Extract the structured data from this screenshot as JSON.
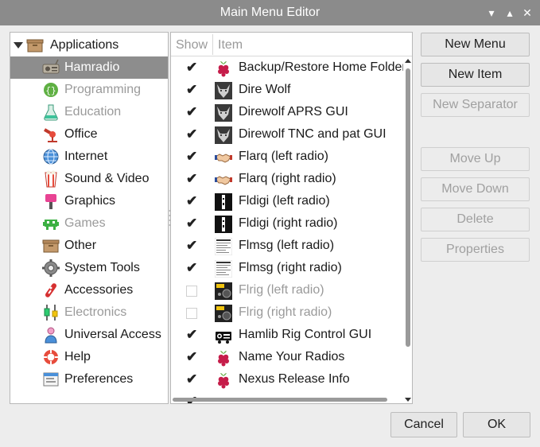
{
  "window": {
    "title": "Main Menu Editor",
    "controls": [
      "minimize-icon",
      "maximize-icon",
      "close-icon"
    ]
  },
  "tree": {
    "root": "Applications",
    "selected": "Hamradio",
    "items": [
      {
        "label": "Hamradio",
        "icon": "hamradio-icon",
        "dim": false
      },
      {
        "label": "Programming",
        "icon": "programming-icon",
        "dim": true
      },
      {
        "label": "Education",
        "icon": "education-icon",
        "dim": true
      },
      {
        "label": "Office",
        "icon": "office-icon",
        "dim": false
      },
      {
        "label": "Internet",
        "icon": "internet-icon",
        "dim": false
      },
      {
        "label": "Sound & Video",
        "icon": "sound-video-icon",
        "dim": false
      },
      {
        "label": "Graphics",
        "icon": "graphics-icon",
        "dim": false
      },
      {
        "label": "Games",
        "icon": "games-icon",
        "dim": true
      },
      {
        "label": "Other",
        "icon": "other-icon",
        "dim": false
      },
      {
        "label": "System Tools",
        "icon": "system-tools-icon",
        "dim": false
      },
      {
        "label": "Accessories",
        "icon": "accessories-icon",
        "dim": false
      },
      {
        "label": "Electronics",
        "icon": "electronics-icon",
        "dim": true
      },
      {
        "label": "Universal Access",
        "icon": "universal-access-icon",
        "dim": false
      },
      {
        "label": "Help",
        "icon": "help-icon",
        "dim": false
      },
      {
        "label": "Preferences",
        "icon": "preferences-icon",
        "dim": false
      }
    ]
  },
  "list": {
    "columns": {
      "show": "Show",
      "item": "Item"
    },
    "items": [
      {
        "label": "Backup/Restore Home Folder",
        "checked": true,
        "icon": "raspberry-icon"
      },
      {
        "label": "Dire Wolf",
        "checked": true,
        "icon": "wolf-icon"
      },
      {
        "label": "Direwolf APRS GUI",
        "checked": true,
        "icon": "wolf-icon"
      },
      {
        "label": "Direwolf TNC and pat GUI",
        "checked": true,
        "icon": "wolf-icon"
      },
      {
        "label": "Flarq (left radio)",
        "checked": true,
        "icon": "handshake-icon"
      },
      {
        "label": "Flarq (right radio)",
        "checked": true,
        "icon": "handshake-icon"
      },
      {
        "label": "Fldigi (left radio)",
        "checked": true,
        "icon": "fldigi-icon"
      },
      {
        "label": "Fldigi (right radio)",
        "checked": true,
        "icon": "fldigi-icon"
      },
      {
        "label": "Flmsg (left radio)",
        "checked": true,
        "icon": "flmsg-icon"
      },
      {
        "label": "Flmsg (right radio)",
        "checked": true,
        "icon": "flmsg-icon"
      },
      {
        "label": "Flrig (left radio)",
        "checked": false,
        "icon": "flrig-icon"
      },
      {
        "label": "Flrig (right radio)",
        "checked": false,
        "icon": "flrig-icon"
      },
      {
        "label": "Hamlib Rig Control GUI",
        "checked": true,
        "icon": "hamlib-icon"
      },
      {
        "label": "Name Your Radios",
        "checked": true,
        "icon": "raspberry-icon"
      },
      {
        "label": "Nexus Release Info",
        "checked": true,
        "icon": "raspberry-icon"
      },
      {
        "label": "",
        "checked": true,
        "icon": ""
      }
    ]
  },
  "buttons": {
    "new_menu": "New Menu",
    "new_item": "New Item",
    "new_separator": "New Separator",
    "move_up": "Move Up",
    "move_down": "Move Down",
    "delete": "Delete",
    "properties": "Properties",
    "cancel": "Cancel",
    "ok": "OK"
  }
}
